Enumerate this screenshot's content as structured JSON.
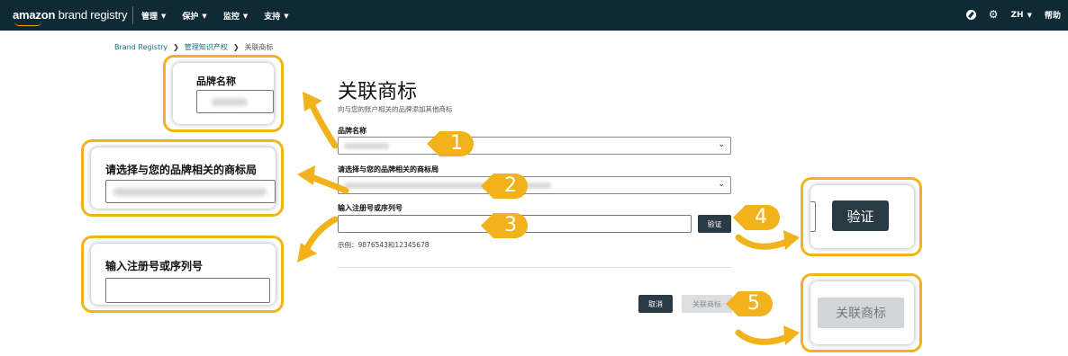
{
  "nav": {
    "logo_bold": "amazon",
    "logo_light": " brand registry",
    "menu": [
      {
        "label": "管理"
      },
      {
        "label": "保护"
      },
      {
        "label": "监控"
      },
      {
        "label": "支持"
      }
    ],
    "language": "ZH",
    "help": "帮助"
  },
  "breadcrumb": {
    "items": [
      "Brand Registry",
      "管理知识产权",
      "关联商标"
    ]
  },
  "form": {
    "title": "关联商标",
    "subtitle": "向与您的账户相关的品牌添加其他商标",
    "brand_label": "品牌名称",
    "office_label": "请选择与您的品牌相关的商标局",
    "reg_label": "输入注册号或序列号",
    "reg_placeholder": "",
    "verify_label": "验证",
    "example": "示例：9876543和12345678",
    "cancel_label": "取消",
    "associate_label": "关联商标"
  },
  "callouts": {
    "brand_label": "品牌名称",
    "office_label": "请选择与您的品牌相关的商标局",
    "reg_label": "输入注册号或序列号",
    "verify_label": "验证",
    "associate_label": "关联商标"
  },
  "badges": [
    "1",
    "2",
    "3",
    "4",
    "5"
  ],
  "colors": {
    "nav_bg": "#0f2a34",
    "callout_border": "#f2b21b",
    "badge_fill": "#f2b21b",
    "primary_button": "#2a3a45",
    "disabled_button": "#dcdfe1",
    "link": "#1b6e8a"
  }
}
